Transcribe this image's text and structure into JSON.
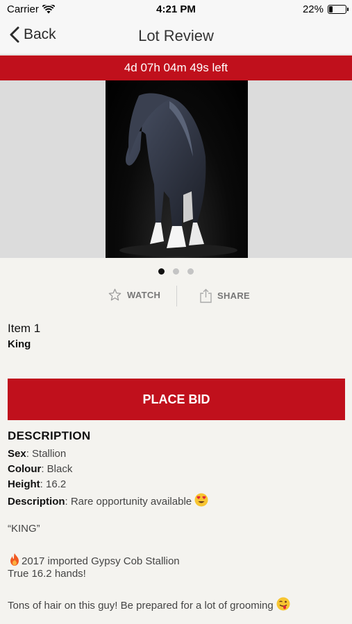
{
  "status": {
    "carrier": "Carrier",
    "time": "4:21 PM",
    "battery": "22%",
    "battery_level": 0.22
  },
  "nav": {
    "back_label": "Back",
    "title": "Lot Review"
  },
  "timer": {
    "text": "4d 07h 04m 49s left"
  },
  "gallery": {
    "page_count": 3,
    "active_page": 1
  },
  "actions": {
    "watch_label": "WATCH",
    "share_label": "SHARE"
  },
  "item": {
    "number": "Item 1",
    "name": "King"
  },
  "bid_button": {
    "label": "PLACE BID"
  },
  "description": {
    "heading": "DESCRIPTION",
    "fields": [
      {
        "label": "Sex",
        "value": ": Stallion"
      },
      {
        "label": "Colour",
        "value": ": Black"
      },
      {
        "label": "Height",
        "value": ": 16.2"
      },
      {
        "label": "Description",
        "value": ": Rare opportunity available"
      }
    ],
    "quote": "“KING”",
    "line1": "2017 imported Gypsy Cob Stallion",
    "line2": "True 16.2 hands!",
    "line3": "Tons of hair on this guy! Be prepared for a lot of grooming"
  },
  "icons": {
    "wifi": "wifi-icon",
    "back": "chevron-left-icon",
    "watch": "star-outline-icon",
    "share": "share-icon",
    "heart_eyes": "heart-eyes-emoji",
    "fire": "fire-emoji",
    "wink_tongue": "wink-tongue-emoji"
  },
  "colors": {
    "accent": "#c0101c",
    "background": "#f4f3ef"
  }
}
